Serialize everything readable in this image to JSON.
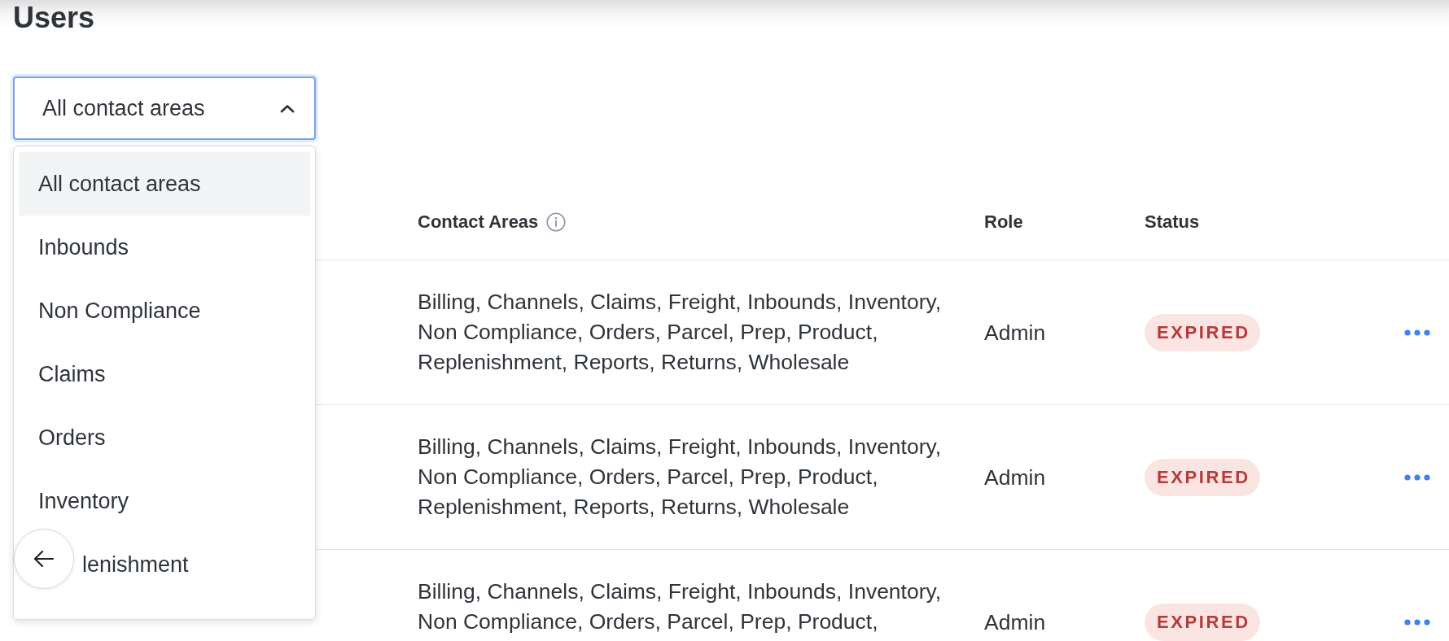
{
  "page": {
    "title": "Users"
  },
  "filter": {
    "value": "All contact areas",
    "expanded": true,
    "options": [
      {
        "label": "All contact areas",
        "selected": true,
        "covered": false
      },
      {
        "label": "Inbounds",
        "selected": false,
        "covered": false
      },
      {
        "label": "Non Compliance",
        "selected": false,
        "covered": false
      },
      {
        "label": "Claims",
        "selected": false,
        "covered": false
      },
      {
        "label": "Orders",
        "selected": false,
        "covered": false
      },
      {
        "label": "Inventory",
        "selected": false,
        "covered": false
      },
      {
        "label": "lenishment",
        "selected": false,
        "covered": true
      }
    ]
  },
  "table": {
    "columns": [
      {
        "label": "Contact Areas",
        "has_info": true
      },
      {
        "label": "Role"
      },
      {
        "label": "Status"
      }
    ],
    "rows": [
      {
        "contact_areas": "Billing, Channels, Claims, Freight, Inbounds, Inventory, Non Compliance, Orders, Parcel, Prep, Product, Replenishment, Reports, Returns, Wholesale",
        "role": "Admin",
        "status": "EXPIRED"
      },
      {
        "contact_areas": "Billing, Channels, Claims, Freight, Inbounds, Inventory, Non Compliance, Orders, Parcel, Prep, Product, Replenishment, Reports, Returns, Wholesale",
        "role": "Admin",
        "status": "EXPIRED"
      },
      {
        "contact_areas": "Billing, Channels, Claims, Freight, Inbounds, Inventory, Non Compliance, Orders, Parcel, Prep, Product,",
        "role": "Admin",
        "status": "EXPIRED"
      }
    ]
  }
}
